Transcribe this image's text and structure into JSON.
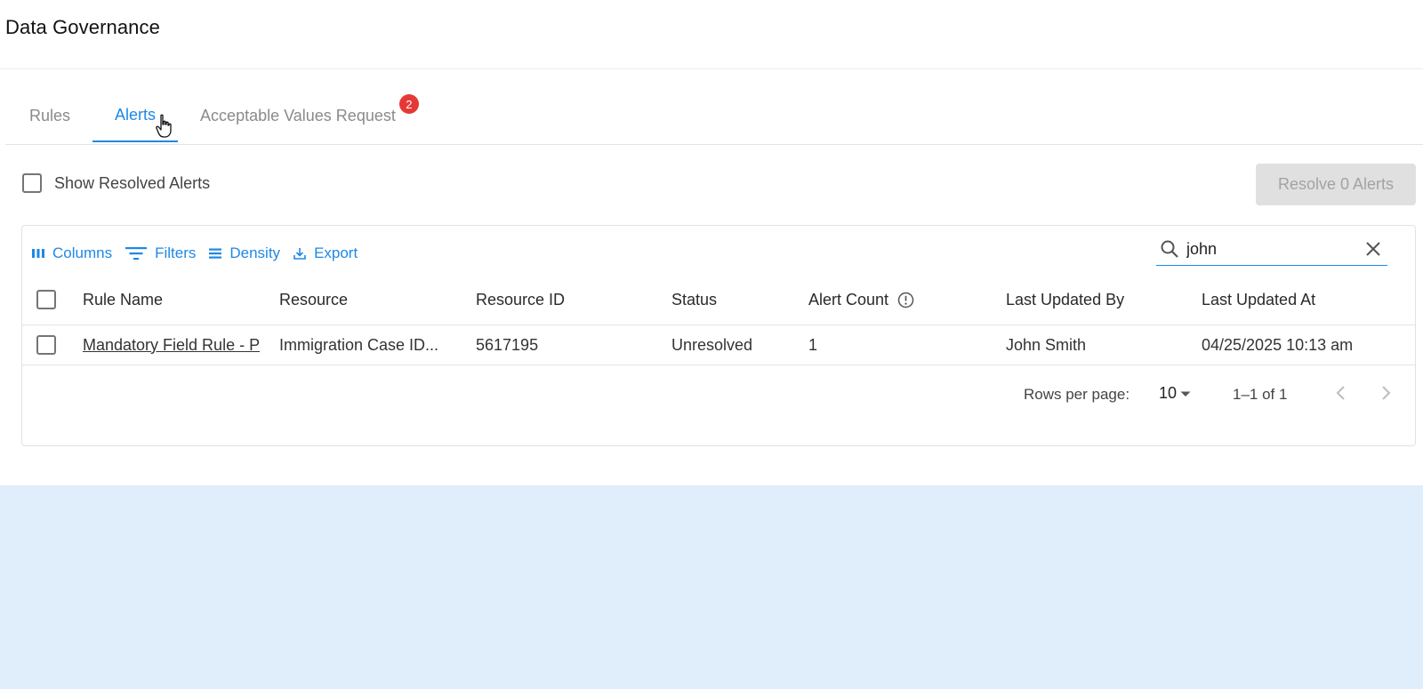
{
  "header": {
    "title": "Data Governance"
  },
  "tabs": [
    {
      "label": "Rules",
      "active": false
    },
    {
      "label": "Alerts",
      "active": true
    },
    {
      "label": "Acceptable Values Request",
      "active": false,
      "badge": "2"
    }
  ],
  "controls": {
    "show_resolved_label": "Show Resolved Alerts",
    "show_resolved_checked": false,
    "resolve_button_label": "Resolve 0 Alerts"
  },
  "toolbar": {
    "columns_label": "Columns",
    "filters_label": "Filters",
    "density_label": "Density",
    "export_label": "Export",
    "search_value": "john"
  },
  "table": {
    "columns": [
      "Rule Name",
      "Resource",
      "Resource ID",
      "Status",
      "Alert Count",
      "Last Updated By",
      "Last Updated At"
    ],
    "rows": [
      {
        "rule_name": "Mandatory Field Rule - P",
        "resource": "Immigration Case ID...",
        "resource_id": "5617195",
        "status": "Unresolved",
        "alert_count": "1",
        "last_updated_by": "John Smith",
        "last_updated_at": "04/25/2025 10:13 am"
      }
    ]
  },
  "pagination": {
    "rows_per_page_label": "Rows per page:",
    "rows_per_page_value": "10",
    "range_label": "1–1 of 1"
  },
  "colors": {
    "accent": "#1e88e5",
    "badge": "#e53935",
    "disabled_bg": "#e0e0e0",
    "footer_bg": "#e0edfa"
  }
}
